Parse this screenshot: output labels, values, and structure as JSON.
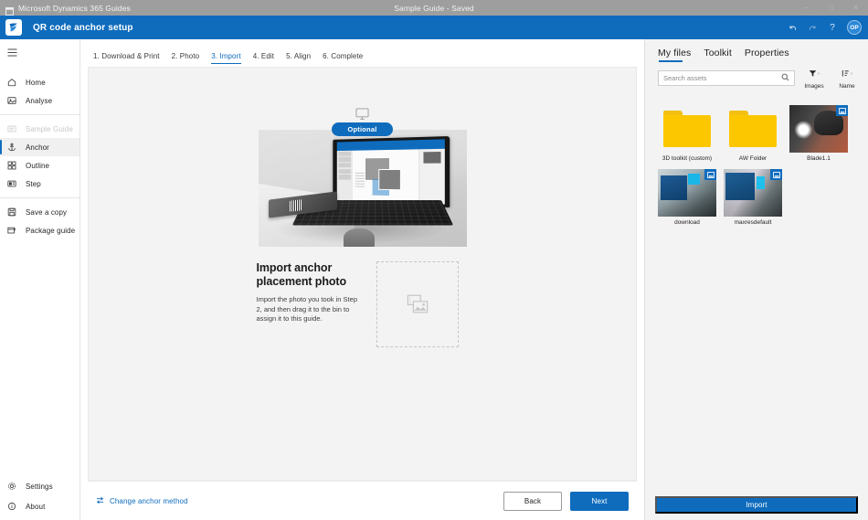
{
  "os_bar": {
    "app_name": "Microsoft Dynamics 365 Guides",
    "document_title": "Sample Guide - Saved",
    "icon": "window-icon",
    "minimize": "–",
    "maximize": "□",
    "close": "✕"
  },
  "app_header": {
    "title": "QR code anchor setup",
    "logo": "dynamics-guides-logo",
    "undo": "undo-icon",
    "redo": "redo-icon",
    "help": "?",
    "avatar_initials": "OP",
    "accent": "#0f6cbd"
  },
  "sidebar": {
    "menu_toggle": "hamburger-icon",
    "items": [
      {
        "label": "Home",
        "icon": "home-icon",
        "state": "normal"
      },
      {
        "label": "Analyse",
        "icon": "analyse-icon",
        "state": "normal"
      },
      {
        "label": "Sample Guide",
        "icon": "guide-icon",
        "state": "disabled"
      },
      {
        "label": "Anchor",
        "icon": "anchor-icon",
        "state": "active"
      },
      {
        "label": "Outline",
        "icon": "outline-icon",
        "state": "normal"
      },
      {
        "label": "Step",
        "icon": "step-icon",
        "state": "normal"
      },
      {
        "label": "Save a copy",
        "icon": "save-copy-icon",
        "state": "normal"
      },
      {
        "label": "Package guide",
        "icon": "package-icon",
        "state": "normal"
      }
    ],
    "bottom_items": [
      {
        "label": "Settings",
        "icon": "gear-icon"
      },
      {
        "label": "About",
        "icon": "info-icon"
      }
    ]
  },
  "wizard": {
    "steps": [
      {
        "label": "1. Download & Print",
        "current": false
      },
      {
        "label": "2. Photo",
        "current": false
      },
      {
        "label": "3. Import",
        "current": true
      },
      {
        "label": "4. Edit",
        "current": false
      },
      {
        "label": "5. Align",
        "current": false
      },
      {
        "label": "6. Complete",
        "current": false
      }
    ],
    "optional_badge": "Optional",
    "monitor_icon": "desktop-monitor-icon",
    "hero_image_alt": "laptop-on-desk-photo",
    "heading": "Import anchor placement photo",
    "body": "Import the photo you took in Step 2, and then drag it to the bin to assign it to this guide.",
    "dropzone_icon": "images-placeholder-icon"
  },
  "action_bar": {
    "change_method_label": "Change anchor method",
    "change_method_icon": "swap-arrows-icon",
    "back_label": "Back",
    "next_label": "Next"
  },
  "right_panel": {
    "tabs": [
      {
        "label": "My files",
        "active": true
      },
      {
        "label": "Toolkit",
        "active": false
      },
      {
        "label": "Properties",
        "active": false
      }
    ],
    "search": {
      "value": "",
      "placeholder": "Search assets",
      "icon": "search-icon"
    },
    "filter": {
      "label": "Images",
      "icon": "filter-icon",
      "caret": "›"
    },
    "sort": {
      "label": "Name",
      "icon": "sort-icon",
      "caret": "›"
    },
    "assets": [
      {
        "name": "3D toolkit (custom)",
        "type": "folder",
        "badge": ""
      },
      {
        "name": "AW Folder",
        "type": "folder",
        "badge": ""
      },
      {
        "name": "Blade1.1",
        "type": "image",
        "badge": "image-badge-icon",
        "art": "ph-blade"
      },
      {
        "name": "download",
        "type": "image",
        "badge": "image-badge-icon",
        "art": "ph-dl"
      },
      {
        "name": "maxresdefault",
        "type": "image",
        "badge": "image-badge-icon",
        "art": "ph-mx"
      }
    ],
    "import_label": "Import"
  }
}
